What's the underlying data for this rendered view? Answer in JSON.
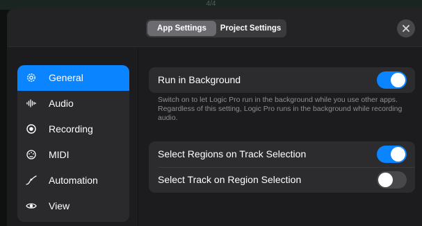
{
  "background": {
    "label": "4/4"
  },
  "header": {
    "tabs": [
      {
        "label": "App Settings",
        "active": true
      },
      {
        "label": "Project Settings",
        "active": false
      }
    ],
    "close_icon": "close-icon"
  },
  "sidebar": {
    "items": [
      {
        "label": "General",
        "icon": "gear-icon",
        "active": true
      },
      {
        "label": "Audio",
        "icon": "waveform-icon",
        "active": false
      },
      {
        "label": "Recording",
        "icon": "record-icon",
        "active": false
      },
      {
        "label": "MIDI",
        "icon": "midi-port-icon",
        "active": false
      },
      {
        "label": "Automation",
        "icon": "automation-curve-icon",
        "active": false
      },
      {
        "label": "View",
        "icon": "eye-icon",
        "active": false
      }
    ]
  },
  "settings": {
    "run_in_background": {
      "label": "Run in Background",
      "enabled": true
    },
    "run_in_background_note": "Switch on to let Logic Pro run in the background while you use other apps. Regardless of this setting, Logic Pro runs in the background while recording audio.",
    "select_regions_on_track": {
      "label": "Select Regions on Track Selection",
      "enabled": true
    },
    "select_track_on_region": {
      "label": "Select Track on Region Selection",
      "enabled": false
    }
  },
  "colors": {
    "accent": "#0a84ff",
    "sheet_background": "#1c1c1e",
    "group_background": "#2c2c2e",
    "secondary_text": "#8e8e93"
  }
}
